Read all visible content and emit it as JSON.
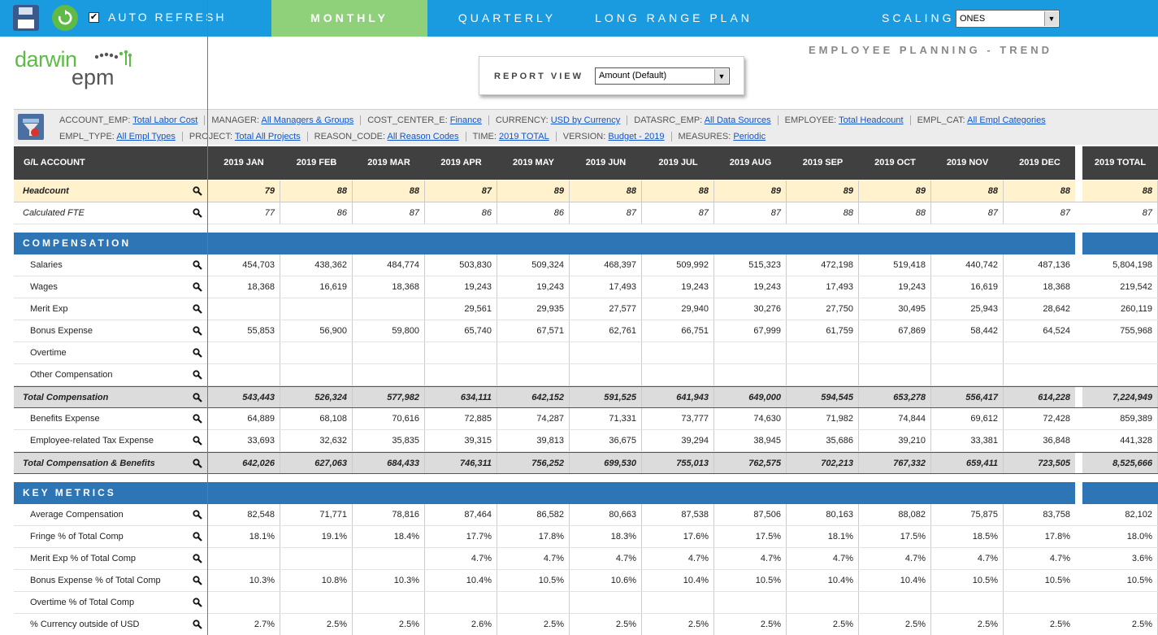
{
  "toolbar": {
    "auto_refresh_label": "AUTO REFRESH",
    "auto_refresh_checked": "✔",
    "tabs": [
      {
        "label": "MONTHLY",
        "active": true
      },
      {
        "label": "QUARTERLY",
        "active": false
      },
      {
        "label": "LONG RANGE PLAN",
        "active": false
      }
    ],
    "scaling_label": "SCALING",
    "scaling_value": "ONES"
  },
  "logo": {
    "word1": "darwin",
    "word2": "epm"
  },
  "report_title": "EMPLOYEE PLANNING - TREND",
  "report_view": {
    "label": "REPORT VIEW",
    "value": "Amount (Default)"
  },
  "pov": {
    "row1": [
      {
        "key": "ACCOUNT_EMP:",
        "value": "Total Labor Cost"
      },
      {
        "key": "MANAGER:",
        "value": "All Managers & Groups"
      },
      {
        "key": "COST_CENTER_E:",
        "value": "Finance"
      },
      {
        "key": "CURRENCY:",
        "value": "USD by Currency"
      },
      {
        "key": "DATASRC_EMP:",
        "value": "All Data Sources"
      },
      {
        "key": "EMPLOYEE:",
        "value": "Total Headcount"
      },
      {
        "key": "EMPL_CAT:",
        "value": "All Empl Categories"
      }
    ],
    "row2": [
      {
        "key": "EMPL_TYPE:",
        "value": "All Empl Types"
      },
      {
        "key": "PROJECT:",
        "value": "Total All Projects"
      },
      {
        "key": "REASON_CODE:",
        "value": "All Reason Codes"
      },
      {
        "key": "TIME:",
        "value": "2019 TOTAL"
      },
      {
        "key": "VERSION:",
        "value": "Budget - 2019"
      },
      {
        "key": "MEASURES:",
        "value": "Periodic"
      }
    ]
  },
  "grid": {
    "account_header": "G/L ACCOUNT",
    "columns": [
      "2019 JAN",
      "2019 FEB",
      "2019 MAR",
      "2019 APR",
      "2019 MAY",
      "2019 JUN",
      "2019 JUL",
      "2019 AUG",
      "2019 SEP",
      "2019 OCT",
      "2019 NOV",
      "2019 DEC",
      "2019 TOTAL"
    ],
    "rows": [
      {
        "type": "yellow",
        "label": "Headcount",
        "style": "italic",
        "values": [
          "79",
          "88",
          "88",
          "87",
          "89",
          "88",
          "88",
          "89",
          "89",
          "89",
          "88",
          "88",
          "88"
        ]
      },
      {
        "type": "white",
        "label": "Calculated FTE",
        "style": "italic-plain",
        "values": [
          "77",
          "86",
          "87",
          "86",
          "86",
          "87",
          "87",
          "87",
          "88",
          "88",
          "87",
          "87",
          "87"
        ]
      },
      {
        "type": "spacer"
      },
      {
        "type": "section",
        "label": "COMPENSATION"
      },
      {
        "type": "white",
        "label": "Salaries",
        "values": [
          "454,703",
          "438,362",
          "484,774",
          "503,830",
          "509,324",
          "468,397",
          "509,992",
          "515,323",
          "472,198",
          "519,418",
          "440,742",
          "487,136",
          "5,804,198"
        ]
      },
      {
        "type": "white",
        "label": "Wages",
        "values": [
          "18,368",
          "16,619",
          "18,368",
          "19,243",
          "19,243",
          "17,493",
          "19,243",
          "19,243",
          "17,493",
          "19,243",
          "16,619",
          "18,368",
          "219,542"
        ]
      },
      {
        "type": "white",
        "label": "Merit Exp",
        "values": [
          "",
          "",
          "",
          "29,561",
          "29,935",
          "27,577",
          "29,940",
          "30,276",
          "27,750",
          "30,495",
          "25,943",
          "28,642",
          "260,119"
        ]
      },
      {
        "type": "white",
        "label": "Bonus Expense",
        "values": [
          "55,853",
          "56,900",
          "59,800",
          "65,740",
          "67,571",
          "62,761",
          "66,751",
          "67,999",
          "61,759",
          "67,869",
          "58,442",
          "64,524",
          "755,968"
        ]
      },
      {
        "type": "white",
        "label": "Overtime",
        "values": [
          "",
          "",
          "",
          "",
          "",
          "",
          "",
          "",
          "",
          "",
          "",
          "",
          ""
        ]
      },
      {
        "type": "white",
        "label": "Other Compensation",
        "values": [
          "",
          "",
          "",
          "",
          "",
          "",
          "",
          "",
          "",
          "",
          "",
          "",
          ""
        ]
      },
      {
        "type": "gray",
        "label": "Total Compensation",
        "values": [
          "543,443",
          "526,324",
          "577,982",
          "634,111",
          "642,152",
          "591,525",
          "641,943",
          "649,000",
          "594,545",
          "653,278",
          "556,417",
          "614,228",
          "7,224,949"
        ]
      },
      {
        "type": "white",
        "label": "Benefits Expense",
        "values": [
          "64,889",
          "68,108",
          "70,616",
          "72,885",
          "74,287",
          "71,331",
          "73,777",
          "74,630",
          "71,982",
          "74,844",
          "69,612",
          "72,428",
          "859,389"
        ]
      },
      {
        "type": "white",
        "label": "Employee-related Tax Expense",
        "values": [
          "33,693",
          "32,632",
          "35,835",
          "39,315",
          "39,813",
          "36,675",
          "39,294",
          "38,945",
          "35,686",
          "39,210",
          "33,381",
          "36,848",
          "441,328"
        ]
      },
      {
        "type": "gray",
        "label": "Total Compensation & Benefits",
        "values": [
          "642,026",
          "627,063",
          "684,433",
          "746,311",
          "756,252",
          "699,530",
          "755,013",
          "762,575",
          "702,213",
          "767,332",
          "659,411",
          "723,505",
          "8,525,666"
        ]
      },
      {
        "type": "spacer"
      },
      {
        "type": "section",
        "label": "KEY METRICS"
      },
      {
        "type": "white",
        "label": "Average Compensation",
        "values": [
          "82,548",
          "71,771",
          "78,816",
          "87,464",
          "86,582",
          "80,663",
          "87,538",
          "87,506",
          "80,163",
          "88,082",
          "75,875",
          "83,758",
          "82,102"
        ]
      },
      {
        "type": "white",
        "label": "Fringe % of Total Comp",
        "values": [
          "18.1%",
          "19.1%",
          "18.4%",
          "17.7%",
          "17.8%",
          "18.3%",
          "17.6%",
          "17.5%",
          "18.1%",
          "17.5%",
          "18.5%",
          "17.8%",
          "18.0%"
        ]
      },
      {
        "type": "white",
        "label": "Merit Exp % of Total Comp",
        "values": [
          "",
          "",
          "",
          "4.7%",
          "4.7%",
          "4.7%",
          "4.7%",
          "4.7%",
          "4.7%",
          "4.7%",
          "4.7%",
          "4.7%",
          "3.6%"
        ]
      },
      {
        "type": "white",
        "label": "Bonus Expense % of Total Comp",
        "values": [
          "10.3%",
          "10.8%",
          "10.3%",
          "10.4%",
          "10.5%",
          "10.6%",
          "10.4%",
          "10.5%",
          "10.4%",
          "10.4%",
          "10.5%",
          "10.5%",
          "10.5%"
        ]
      },
      {
        "type": "white",
        "label": "Overtime % of Total Comp",
        "values": [
          "",
          "",
          "",
          "",
          "",
          "",
          "",
          "",
          "",
          "",
          "",
          "",
          ""
        ]
      },
      {
        "type": "white",
        "label": "% Currency outside of USD",
        "values": [
          "2.7%",
          "2.5%",
          "2.5%",
          "2.6%",
          "2.5%",
          "2.5%",
          "2.5%",
          "2.5%",
          "2.5%",
          "2.5%",
          "2.5%",
          "2.5%",
          "2.5%"
        ]
      }
    ]
  },
  "colors": {
    "topbar": "#1a9be0",
    "active_tab": "#8fd07a",
    "header_row": "#404040",
    "section_row": "#2e75b6",
    "headcount_row": "#fff2cc",
    "total_row": "#dcdcdc",
    "link": "#1155cc"
  },
  "icons": [
    "save-icon",
    "refresh-icon",
    "checkbox-icon",
    "dropdown-arrow-icon",
    "filter-icon",
    "magnifier-icon"
  ]
}
